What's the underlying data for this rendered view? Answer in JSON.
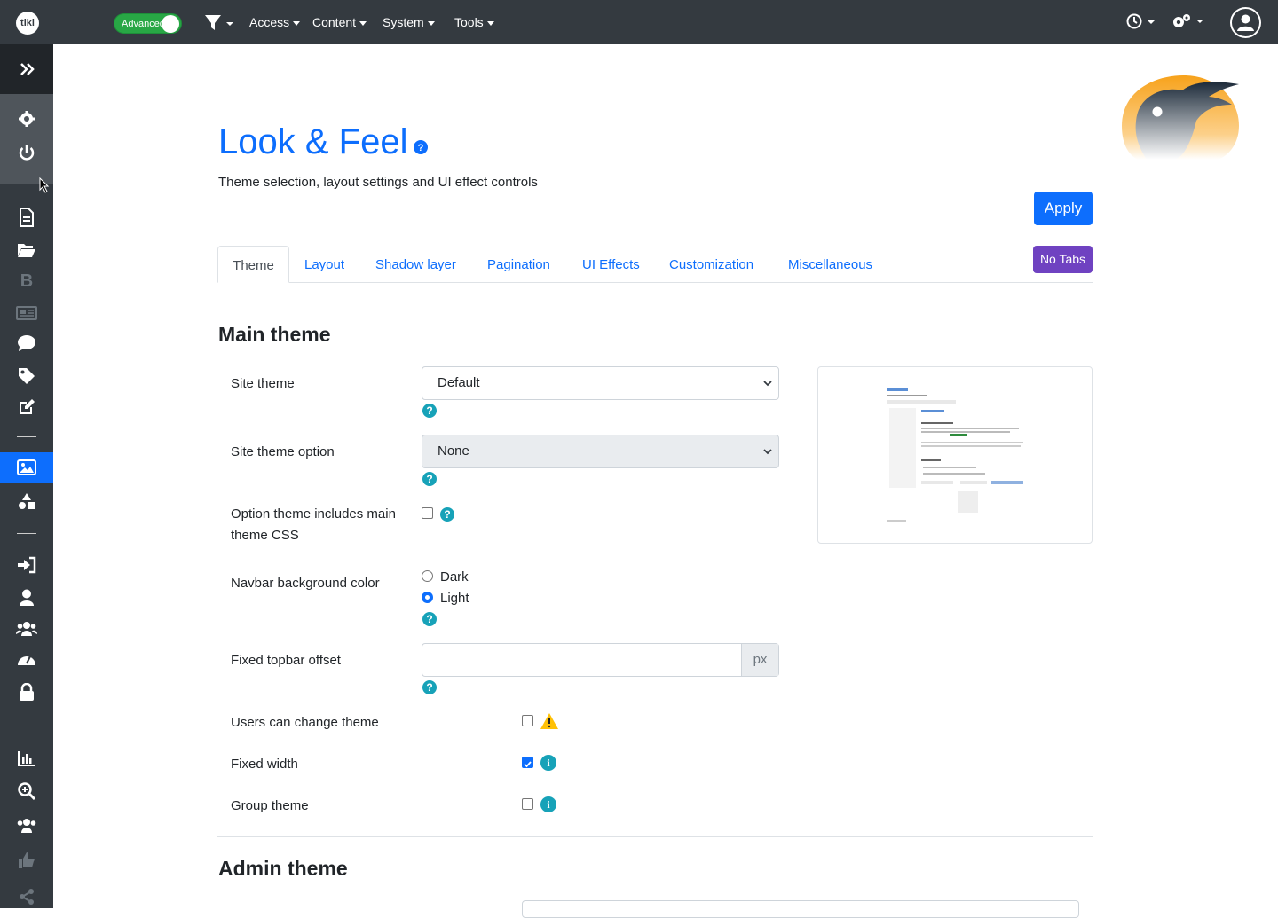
{
  "topbar": {
    "logo_text": "tiki",
    "toggle_label": "Advanced",
    "menus": [
      "Access",
      "Content",
      "System",
      "Tools"
    ]
  },
  "page": {
    "title": "Look & Feel",
    "description": "Theme selection, layout settings and UI effect controls",
    "apply_label": "Apply",
    "notabs_label": "No Tabs"
  },
  "tabs": [
    "Theme",
    "Layout",
    "Shadow layer",
    "Pagination",
    "UI Effects",
    "Customization",
    "Miscellaneous"
  ],
  "main_theme": {
    "heading": "Main theme",
    "site_theme_label": "Site theme",
    "site_theme_value": "Default",
    "site_theme_option_label": "Site theme option",
    "site_theme_option_value": "None",
    "option_includes_label": "Option theme includes main theme CSS",
    "navbar_bg_label": "Navbar background color",
    "navbar_options": [
      "Dark",
      "Light"
    ],
    "navbar_selected": "Light",
    "topbar_offset_label": "Fixed topbar offset",
    "topbar_offset_value": "",
    "topbar_offset_unit": "px",
    "users_change_label": "Users can change theme",
    "fixed_width_label": "Fixed width",
    "group_theme_label": "Group theme"
  },
  "admin_theme": {
    "heading": "Admin theme"
  },
  "colors": {
    "navbar": "#343a40",
    "primary": "#0d6efd",
    "purple": "#6f42c1",
    "toggle_green": "#28a745",
    "help_teal": "#17a2b8",
    "warning": "#ffc107"
  },
  "icons": {
    "sidebar": [
      "double-chevron-right-icon",
      "gear-icon",
      "power-icon",
      "file-icon",
      "folder-open-icon",
      "bold-b-icon",
      "newspaper-icon",
      "comment-icon",
      "tag-icon",
      "edit-icon",
      "image-icon",
      "shapes-icon",
      "sign-in-icon",
      "user-icon",
      "users-icon",
      "tachometer-icon",
      "lock-icon",
      "chart-bar-icon",
      "search-plus-icon",
      "user-group-icon",
      "thumbs-up-icon",
      "share-icon"
    ]
  }
}
